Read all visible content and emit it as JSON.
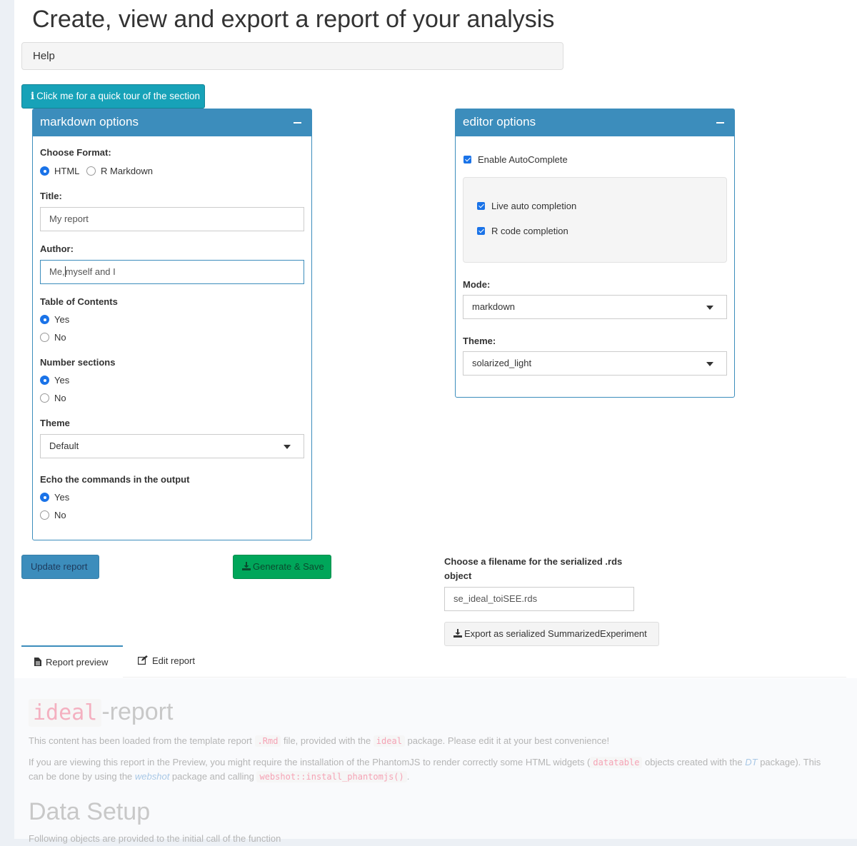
{
  "page": {
    "title": "Create, view and export a report of your analysis"
  },
  "help": {
    "label": "Help"
  },
  "tour_button": {
    "label": "Click me for a quick tour of the section"
  },
  "markdown_box": {
    "title": "markdown options",
    "format": {
      "label": "Choose Format:",
      "options": [
        "HTML",
        "R Markdown"
      ],
      "selected": "HTML"
    },
    "title_field": {
      "label": "Title:",
      "value": "My report"
    },
    "author_field": {
      "label": "Author:",
      "value_before_cursor": "Me,",
      "value_after_cursor": "myself and I"
    },
    "toc": {
      "label": "Table of Contents",
      "options": [
        "Yes",
        "No"
      ],
      "selected": "Yes"
    },
    "number_sections": {
      "label": "Number sections",
      "options": [
        "Yes",
        "No"
      ],
      "selected": "Yes"
    },
    "theme": {
      "label": "Theme",
      "value": "Default"
    },
    "echo": {
      "label": "Echo the commands in the output",
      "options": [
        "Yes",
        "No"
      ],
      "selected": "Yes"
    }
  },
  "editor_box": {
    "title": "editor options",
    "enable_autocomplete": {
      "label": "Enable AutoComplete",
      "checked": true
    },
    "live_completion": {
      "label": "Live auto completion",
      "checked": true
    },
    "r_completion": {
      "label": "R code completion",
      "checked": true
    },
    "mode": {
      "label": "Mode:",
      "value": "markdown"
    },
    "theme": {
      "label": "Theme:",
      "value": "solarized_light"
    }
  },
  "actions": {
    "update": "Update report",
    "generate": "Generate & Save",
    "filename_label": "Choose a filename for the serialized .rds object",
    "filename_value": "se_ideal_toiSEE.rds",
    "export": "Export as serialized SummarizedExperiment"
  },
  "tabs": [
    {
      "label": "Report preview",
      "icon": "file-icon",
      "active": true
    },
    {
      "label": "Edit report",
      "icon": "edit-icon",
      "active": false
    }
  ],
  "preview": {
    "title_code": "ideal",
    "title_rest": "-report",
    "p1": {
      "t1": "This content has been loaded from the template report ",
      "c1": ".Rmd",
      "t2": " file, provided with the ",
      "c2": "ideal",
      "t3": " package. Please edit it at your best convenience!"
    },
    "p2": {
      "t1": "If you are viewing this report in the Preview, you might require the installation of the PhantomJS to render correctly some HTML widgets (",
      "c1": "datatable",
      "t2": " objects created with the ",
      "l1": "DT",
      "t3": " package). This can be done by using the ",
      "l2": "webshot",
      "t4": " package and calling ",
      "c2": "webshot::install_phantomjs()",
      "t5": "."
    },
    "h2": "Data Setup",
    "p3": "Following objects are provided to the initial call of the function"
  }
}
